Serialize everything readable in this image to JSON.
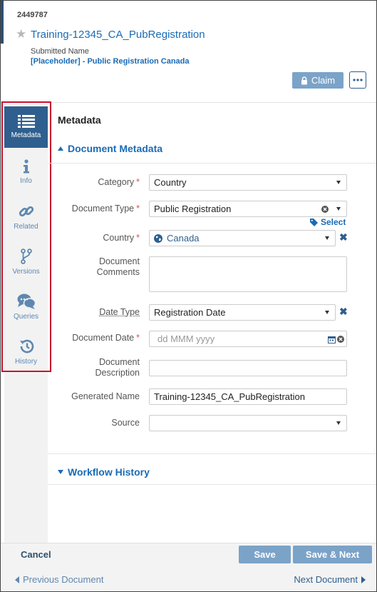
{
  "header": {
    "doc_id": "2449787",
    "title": "Training-12345_CA_PubRegistration",
    "submitted_label": "Submitted Name",
    "submitted_value": "[Placeholder] - Public Registration Canada",
    "claim_label": "Claim"
  },
  "sidebar": {
    "items": [
      {
        "label": "Metadata",
        "icon": "list-icon",
        "active": true
      },
      {
        "label": "Info",
        "icon": "info-icon"
      },
      {
        "label": "Related",
        "icon": "link-icon"
      },
      {
        "label": "Versions",
        "icon": "branch-icon"
      },
      {
        "label": "Queries",
        "icon": "chat-icon"
      },
      {
        "label": "History",
        "icon": "history-icon"
      }
    ]
  },
  "content": {
    "title": "Metadata",
    "section_metadata": "Document Metadata",
    "section_workflow": "Workflow History",
    "select_label": "Select"
  },
  "fields": {
    "category": {
      "label": "Category",
      "value": "Country"
    },
    "document_type": {
      "label": "Document Type",
      "value": "Public Registration"
    },
    "country": {
      "label": "Country",
      "value": "Canada"
    },
    "document_comments": {
      "label_line1": "Document",
      "label_line2": "Comments"
    },
    "date_type": {
      "label": "Date Type",
      "value": "Registration Date"
    },
    "document_date": {
      "label": "Document Date",
      "placeholder": "dd MMM yyyy"
    },
    "document_description": {
      "label_line1": "Document",
      "label_line2": "Description"
    },
    "generated_name": {
      "label": "Generated Name",
      "value": "Training-12345_CA_PubRegistration"
    },
    "source": {
      "label": "Source",
      "value": ""
    }
  },
  "footer": {
    "cancel": "Cancel",
    "save": "Save",
    "save_next": "Save & Next",
    "previous": "Previous Document",
    "next": "Next Document"
  },
  "colors": {
    "accent": "#2f5f8e",
    "link": "#1a6bb5",
    "button": "#7ba3c8",
    "highlight_box": "#c8102e",
    "required": "#d9534f"
  }
}
